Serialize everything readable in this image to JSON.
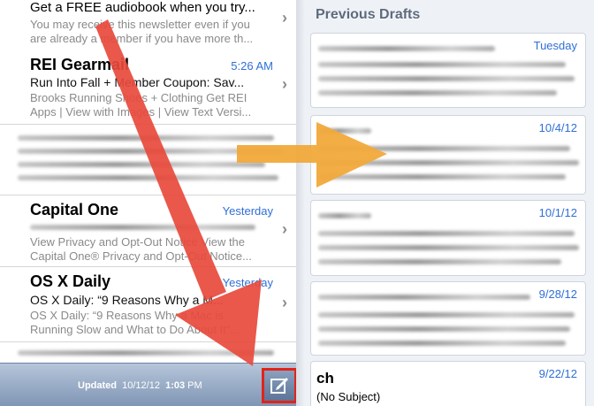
{
  "inbox": {
    "items": [
      {
        "sender": "Get a FREE audiobook when you try...",
        "preview": [
          "You may receive this newsletter even if you",
          "are already a member if you have more th..."
        ]
      },
      {
        "sender": "REI Gearmail",
        "time": "5:26 AM",
        "subject": "Run Into Fall + Member Coupon: Sav...",
        "preview": [
          "Brooks Running Shoes + Clothing Get REI",
          "Apps | View with Images | View Text Versi..."
        ]
      },
      {
        "sender": "Capital One",
        "time": "Yesterday",
        "preview": [
          "View Privacy and Opt-Out Notice View the",
          "Capital One® Privacy and Opt-Out Notice..."
        ]
      },
      {
        "sender": "OS X Daily",
        "time": "Yesterday",
        "subject": "OS X Daily: “9 Reasons Why a M...",
        "preview": [
          "OS X Daily: “9 Reasons Why a Mac is",
          "Running Slow and What to Do About It”..."
        ]
      }
    ]
  },
  "footer": {
    "label": "Updated",
    "date": "10/12/12",
    "time": "1:03",
    "ampm": "PM"
  },
  "drafts": {
    "title": "Previous Drafts",
    "items": [
      {
        "date": "Tuesday"
      },
      {
        "date": "10/4/12"
      },
      {
        "date": "10/1/12"
      },
      {
        "date": "9/28/12"
      },
      {
        "date": "9/22/12",
        "sender": "ch",
        "subject": "(No Subject)"
      }
    ]
  },
  "colors": {
    "arrow_red": "#e84a3c",
    "arrow_orange": "#f2a93b",
    "accent_blue": "#2f6fd6",
    "highlight": "#e2231a"
  }
}
